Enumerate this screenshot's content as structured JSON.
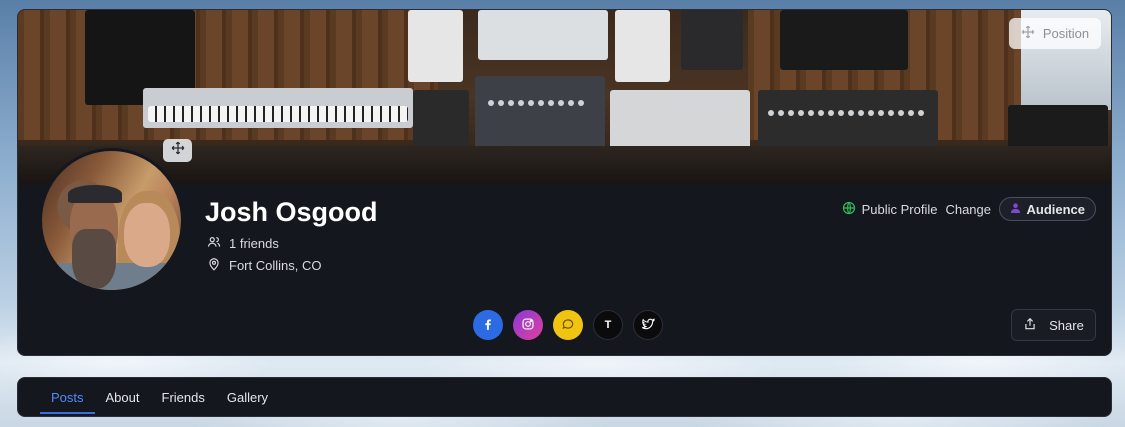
{
  "cover": {
    "position_label": "Position"
  },
  "profile": {
    "name": "Josh Osgood",
    "friends": "1 friends",
    "location": "Fort Collins, CO",
    "visibility": "Public Profile",
    "change_label": "Change",
    "audience_label": "Audience"
  },
  "socials": [
    {
      "icon": "facebook-icon",
      "color": "#2d6be4"
    },
    {
      "icon": "instagram-icon",
      "color": "#c13fd0"
    },
    {
      "icon": "chat-icon",
      "color": "#f2c412"
    },
    {
      "icon": "tiktok-icon",
      "label": "T",
      "color": "#0b0b0d"
    },
    {
      "icon": "twitter-icon",
      "color": "#0b0b0d"
    }
  ],
  "share_label": "Share",
  "tabs": [
    {
      "label": "Posts",
      "active": true
    },
    {
      "label": "About"
    },
    {
      "label": "Friends"
    },
    {
      "label": "Gallery"
    }
  ],
  "colors": {
    "accent": "#4f8cff",
    "card_bg": "#15171f",
    "globe": "#2fbf5a",
    "audience_icon": "#7a4bd1"
  }
}
